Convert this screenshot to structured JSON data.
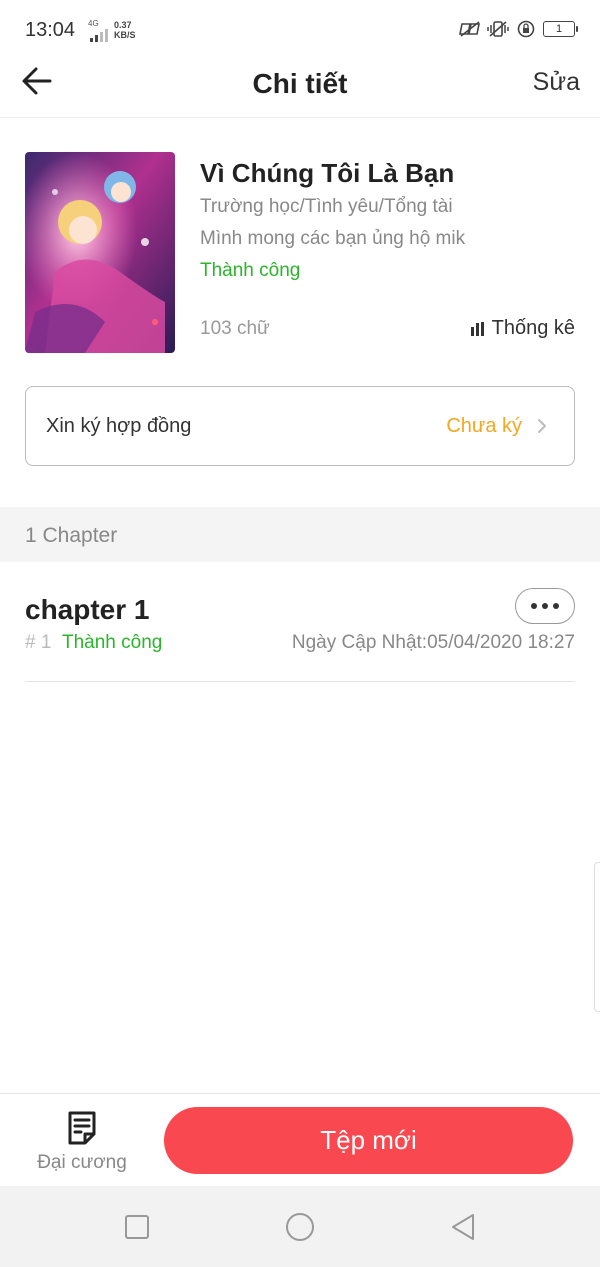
{
  "status_bar": {
    "time": "13:04",
    "network": "4G",
    "speed_value": "0.37",
    "speed_unit": "KB/S",
    "battery": "1"
  },
  "header": {
    "title": "Chi tiết",
    "edit_label": "Sửa"
  },
  "book": {
    "title": "Vì Chúng Tôi Là Bạn",
    "genres": "Trường học/Tình yêu/Tổng tài",
    "description": "Mình mong các bạn ủng hộ mik",
    "status": "Thành công",
    "word_count": "103 chữ",
    "stats_label": "Thống kê"
  },
  "contract": {
    "label": "Xin ký hợp đồng",
    "status": "Chưa ký"
  },
  "chapters": {
    "count_label": "1 Chapter",
    "items": [
      {
        "title": "chapter 1",
        "number": "# 1",
        "status": "Thành công",
        "updated": "Ngày Cập Nhật:05/04/2020 18:27"
      }
    ]
  },
  "bottom_bar": {
    "outline_label": "Đại cương",
    "new_file_label": "Tệp mới"
  },
  "colors": {
    "accent": "#f9484f",
    "success": "#2bb52b",
    "warning": "#f5a623"
  }
}
